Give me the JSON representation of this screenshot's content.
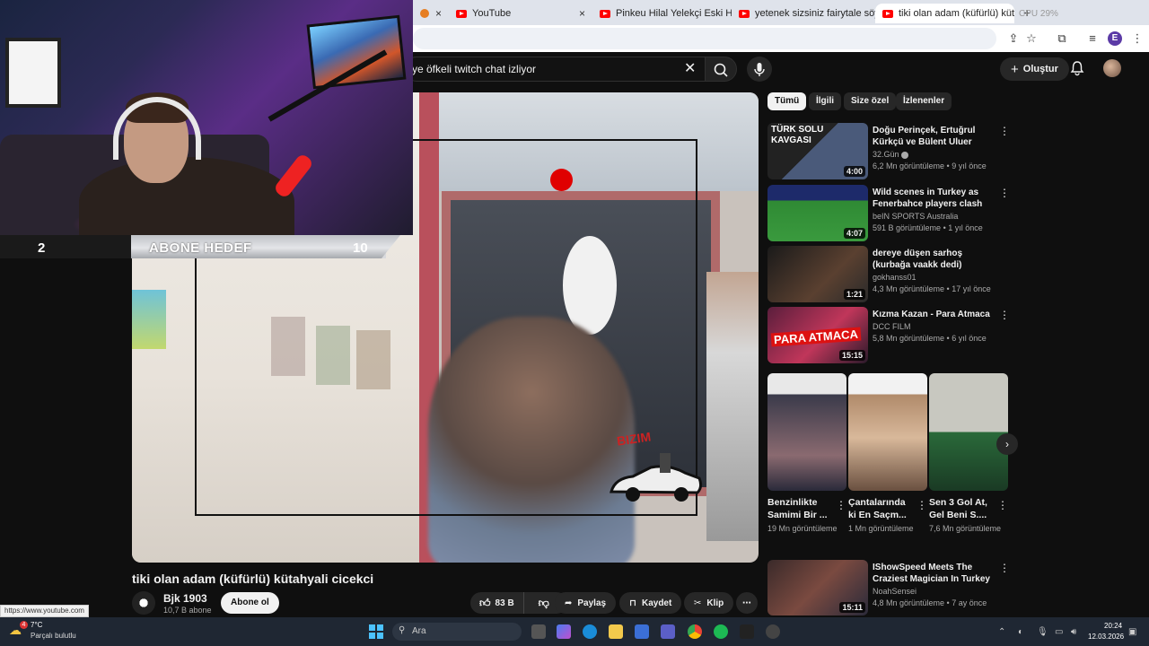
{
  "browser": {
    "tabs": [
      {
        "label": "YouTube",
        "active": false
      },
      {
        "label": "Pinkeu Hilal Yelekçi Eski Hali - Y",
        "active": false
      },
      {
        "label": "yetenek sizsiniz fairytale söyley",
        "active": false
      },
      {
        "label": "tiki olan adam (küfürlü) kütahy",
        "active": true
      }
    ],
    "new_tab": "+",
    "stats": "CPU 29%"
  },
  "header": {
    "search_query": "ye öfkeli twitch chat izliyor",
    "create_label": "Oluştur"
  },
  "stream_overlay": {
    "goal_current": "2",
    "goal_label": "ABONE HEDEF",
    "goal_target": "10",
    "logo_text": "BIZIM"
  },
  "video": {
    "title": "tiki olan adam (küfürlü) kütahyali cicekci",
    "channel": "Bjk 1903",
    "subscribers": "10,7 B abone",
    "subscribe_label": "Abone ol",
    "likes": "83 B",
    "share_label": "Paylaş",
    "save_label": "Kaydet",
    "clip_label": "Klip",
    "status_url": "https://www.youtube.com"
  },
  "chips": [
    "Tümü",
    "İlgili",
    "Size özel",
    "İzlenenler"
  ],
  "recommendations": [
    {
      "title": "Doğu Perinçek, Ertuğrul Kürkçü ve Bülent Uluer Kavgası | ...",
      "channel": "32.Gün",
      "verified": true,
      "views": "6,2 Mn görüntüleme",
      "age": "9 yıl önce",
      "duration": "4:00",
      "thumb_text": "TÜRK SOLU KAVGASI"
    },
    {
      "title": "Wild scenes in Turkey as Fenerbahce players clash with...",
      "channel": "beIN SPORTS Australia",
      "verified": false,
      "views": "591 B görüntüleme",
      "age": "1 yıl önce",
      "duration": "4:07",
      "thumb_text": ""
    },
    {
      "title": "dereye düşen sarhoş (kurbağa vaakk dedi)",
      "channel": "gokhanss01",
      "verified": false,
      "views": "4,3 Mn görüntüleme",
      "age": "17 yıl önce",
      "duration": "1:21",
      "thumb_text": ""
    },
    {
      "title": "Kızma Kazan - Para Atmaca",
      "channel": "DCC FILM",
      "verified": false,
      "views": "5,8 Mn görüntüleme",
      "age": "6 yıl önce",
      "duration": "15:15",
      "thumb_text": "PARA ATMACA"
    },
    {
      "title": "IShowSpeed Meets The Craziest Magician In Turkey 😮",
      "channel": "NoahSensei",
      "verified": false,
      "views": "4,8 Mn görüntüleme",
      "age": "7 ay önce",
      "duration": "15:11",
      "thumb_text": ""
    }
  ],
  "shorts": [
    {
      "title": "Benzinlikte Samimi Bir ...",
      "views": "19 Mn görüntüleme"
    },
    {
      "title": "Çantalarında ki En Saçm...",
      "views": "1 Mn görüntüleme"
    },
    {
      "title": "Sen 3 Gol At, Gel Beni S....",
      "views": "7,6 Mn görüntüleme"
    }
  ],
  "taskbar": {
    "weather_temp": "7°C",
    "weather_desc": "Parçalı bulutlu",
    "weather_badge": "4",
    "search_placeholder": "Ara",
    "time": "20:24",
    "date": "12.03.2026"
  },
  "colors": {
    "accent": "#ff0000",
    "background": "#0f0f0f",
    "chip_active": "#f1f1f1"
  }
}
